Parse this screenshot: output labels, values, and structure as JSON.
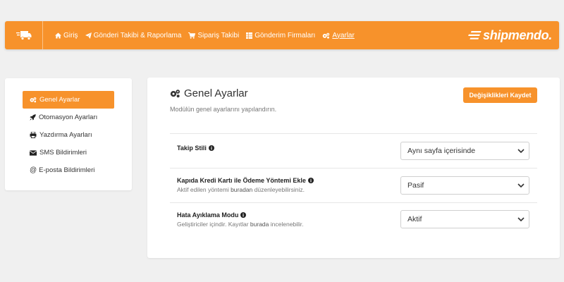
{
  "nav": {
    "items": [
      {
        "label": "Giriş"
      },
      {
        "label": "Gönderi Takibi & Raporlama"
      },
      {
        "label": "Sipariş Takibi"
      },
      {
        "label": "Gönderim Firmaları"
      },
      {
        "label": "Ayarlar"
      }
    ]
  },
  "brand": {
    "name": "shipmendo."
  },
  "sidebar": {
    "items": [
      {
        "label": "Genel Ayarlar"
      },
      {
        "label": "Otomasyon Ayarları"
      },
      {
        "label": "Yazdırma Ayarları"
      },
      {
        "label": "SMS Bildirimleri"
      },
      {
        "label": "E-posta Bildirimleri"
      }
    ]
  },
  "main": {
    "title": "Genel Ayarlar",
    "subtitle": "Modülün genel ayarlarını yapılandırın.",
    "save_label": "Değişiklikleri Kaydet",
    "settings": [
      {
        "label": "Takip Stili",
        "value": "Aynı sayfa içerisinde"
      },
      {
        "label": "Kapıda Kredi Kartı ile Ödeme Yöntemi Ekle",
        "desc_pre": "Aktif edilen yöntemi ",
        "desc_link": "buradan",
        "desc_post": " düzenleyebilirsiniz.",
        "value": "Pasif"
      },
      {
        "label": "Hata Ayıklama Modu",
        "desc_pre": "Geliştiriciler içindir. Kayıtlar ",
        "desc_link": "burada",
        "desc_post": " incelenebilir.",
        "value": "Aktif"
      }
    ]
  },
  "colors": {
    "accent": "#f7922b"
  }
}
